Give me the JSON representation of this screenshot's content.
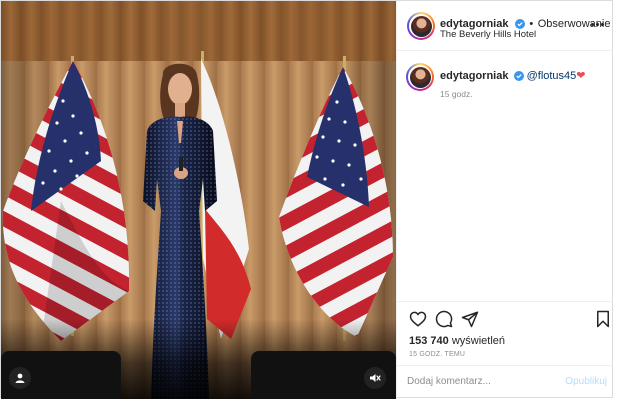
{
  "post": {
    "author": {
      "username": "edytagorniak",
      "verified": true,
      "follow_label": "Obserwowanie",
      "separator": "•"
    },
    "location": "The Beverly Hills Hotel",
    "caption": {
      "username": "edytagorniak",
      "mention": "@flotus45",
      "emoji": "❤"
    },
    "caption_time": "15 godz.",
    "views_count": "153 740",
    "views_label": "wyświetleń",
    "posted_ago": "15 GODZ. TEMU",
    "comment": {
      "placeholder": "Dodaj komentarz...",
      "value": "",
      "publish_label": "Opublikuj"
    }
  },
  "colors": {
    "verified_blue": "#3897f0",
    "mention_blue": "#00376b",
    "publish_disabled": "#b2dffc",
    "heart_red": "#ed4956"
  },
  "icons": {
    "like": "heart-icon",
    "comment": "comment-icon",
    "share": "paper-plane-icon",
    "save": "bookmark-icon",
    "more": "more-options-icon",
    "mute": "speaker-muted-icon",
    "tags": "user-tag-icon"
  }
}
